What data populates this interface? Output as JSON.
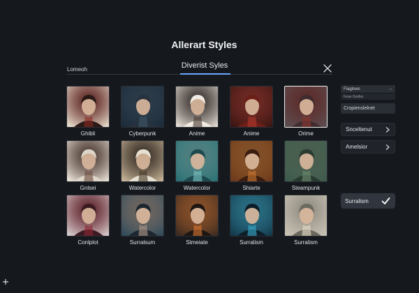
{
  "header": {
    "title": "Allerart Styles",
    "left_label": "Lomeoh",
    "tab_title": "Diverist Syles"
  },
  "styles": [
    {
      "label": "Ghibli",
      "palette": [
        "#e9e2d2",
        "#8b2a22",
        "#2a1a16"
      ]
    },
    {
      "label": "Cyberpunk",
      "palette": [
        "#1c2b3a",
        "#3f5668",
        "#27323e"
      ]
    },
    {
      "label": "Anime",
      "palette": [
        "#e7e2da",
        "#4a3a32",
        "#f0ebe3"
      ]
    },
    {
      "label": "Anime",
      "palette": [
        "#3a1512",
        "#b2392c",
        "#6b1f18"
      ]
    },
    {
      "label": "Orime",
      "palette": [
        "#5a4e52",
        "#8c3630",
        "#3f2c2e"
      ]
    },
    {
      "label": "Gnlsei",
      "palette": [
        "#ece6dc",
        "#6b4a3a",
        "#dcd5c8"
      ]
    },
    {
      "label": "Watercolor",
      "palette": [
        "#c9b69a",
        "#4a3827",
        "#e6e0d2"
      ]
    },
    {
      "label": "Watercolor",
      "palette": [
        "#2a6f73",
        "#7fc7c4",
        "#1d4a4f"
      ]
    },
    {
      "label": "Shiarte",
      "palette": [
        "#6b3a1b",
        "#d07a32",
        "#3a1d10"
      ]
    },
    {
      "label": "Steampunk",
      "palette": [
        "#3d5a4c",
        "#6f8d70",
        "#2a3b32"
      ]
    },
    {
      "label": "Conlplot",
      "palette": [
        "#d8cfcf",
        "#8e2632",
        "#3a1b22"
      ]
    },
    {
      "label": "Surralsum",
      "palette": [
        "#2f4a5a",
        "#b49d8b",
        "#1c2730"
      ]
    },
    {
      "label": "Stmeiate",
      "palette": [
        "#3b2a1f",
        "#e07a33",
        "#1d1612"
      ]
    },
    {
      "label": "Surralism",
      "palette": [
        "#14384a",
        "#3ab0d0",
        "#0d1e29"
      ]
    },
    {
      "label": "Surralism",
      "palette": [
        "#c8c2b5",
        "#e6dcc6",
        "#6b6a5f"
      ]
    }
  ],
  "selected_index": 4,
  "sidebar": {
    "pill_top": "Fiaglows",
    "pill_sub": "Feae Giaifes",
    "option_field": "Cropienslelnet",
    "btn1": "Snceltenut",
    "btn2": "Amelsior",
    "surreal_label": "Surralism"
  },
  "colors": {
    "accent": "#6aa8ff",
    "background": "#15181d"
  }
}
